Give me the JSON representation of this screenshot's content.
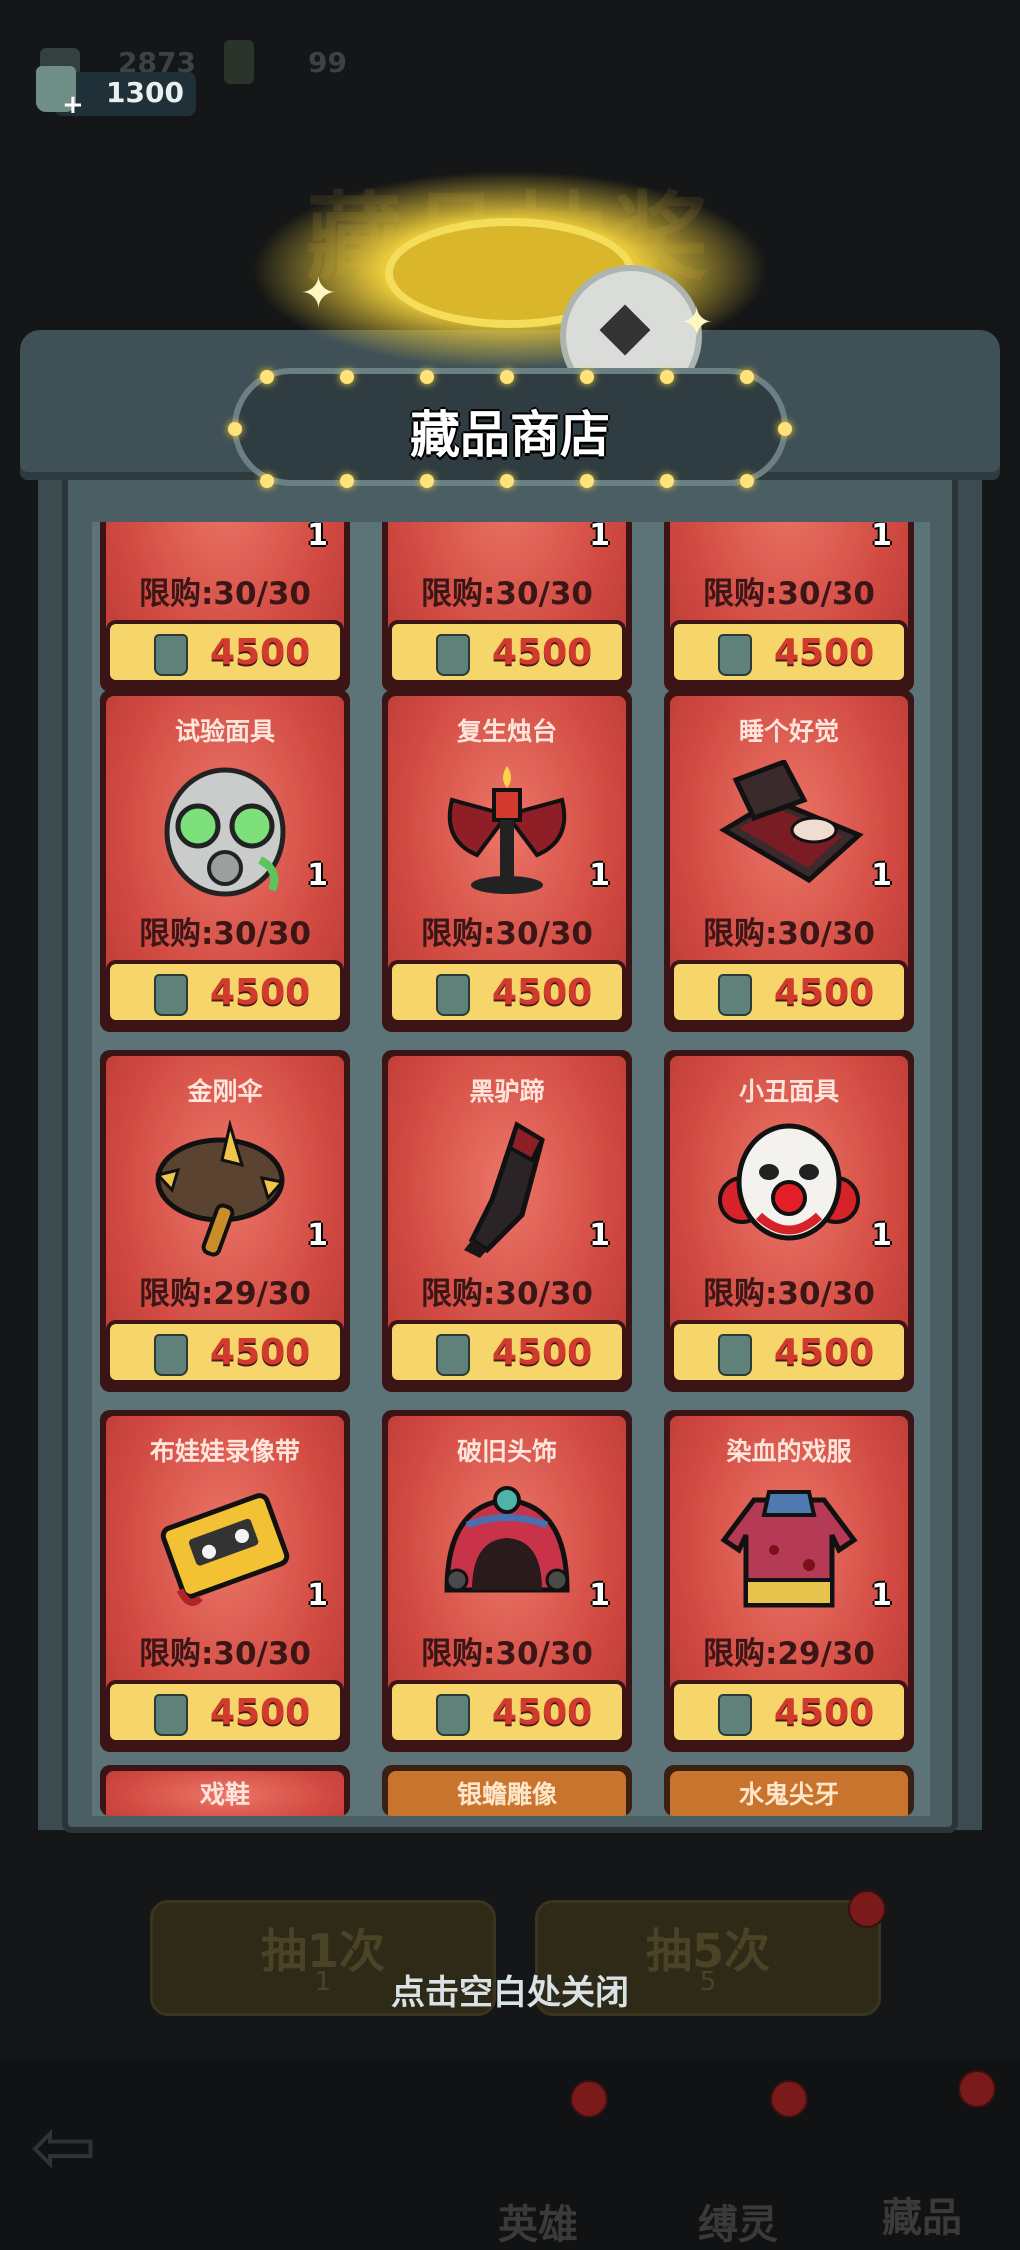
{
  "currency": [
    {
      "amount": "2873",
      "icon": "collectible-token-icon"
    },
    {
      "amount": "99",
      "icon": "key-icon"
    },
    {
      "amount": "1300",
      "icon": "collectible-token-icon"
    }
  ],
  "background": {
    "title": "藏品抽奖",
    "draw_buttons": [
      {
        "label": "抽1次",
        "cost": "1"
      },
      {
        "label": "抽5次",
        "cost": "5"
      }
    ],
    "nav": [
      {
        "label": "英雄"
      },
      {
        "label": "缚灵"
      },
      {
        "label": "藏品"
      }
    ]
  },
  "modal": {
    "title": "藏品商店",
    "close_hint": "点击空白处关闭"
  },
  "shop": {
    "top_row": [
      {
        "count": "1",
        "limit": "限购:30/30",
        "price": "4500"
      },
      {
        "count": "1",
        "limit": "限购:30/30",
        "price": "4500"
      },
      {
        "count": "1",
        "limit": "限购:30/30",
        "price": "4500"
      }
    ],
    "items": [
      {
        "name": "试验面具",
        "count": "1",
        "limit": "限购:30/30",
        "price": "4500",
        "icon": "gas-mask-icon"
      },
      {
        "name": "复生烛台",
        "count": "1",
        "limit": "限购:30/30",
        "price": "4500",
        "icon": "candlestick-icon"
      },
      {
        "name": "睡个好觉",
        "count": "1",
        "limit": "限购:30/30",
        "price": "4500",
        "icon": "coffin-icon"
      },
      {
        "name": "金刚伞",
        "count": "1",
        "limit": "限购:29/30",
        "price": "4500",
        "icon": "spiked-umbrella-icon"
      },
      {
        "name": "黑驴蹄",
        "count": "1",
        "limit": "限购:30/30",
        "price": "4500",
        "icon": "donkey-hoof-icon"
      },
      {
        "name": "小丑面具",
        "count": "1",
        "limit": "限购:30/30",
        "price": "4500",
        "icon": "clown-mask-icon"
      },
      {
        "name": "布娃娃录像带",
        "count": "1",
        "limit": "限购:30/30",
        "price": "4500",
        "icon": "cassette-tape-icon"
      },
      {
        "name": "破旧头饰",
        "count": "1",
        "limit": "限购:30/30",
        "price": "4500",
        "icon": "headdress-icon"
      },
      {
        "name": "染血的戏服",
        "count": "1",
        "limit": "限购:29/30",
        "price": "4500",
        "icon": "costume-icon"
      }
    ],
    "partial_row": [
      {
        "name": "戏鞋"
      },
      {
        "name": "银蟾雕像"
      },
      {
        "name": "水鬼尖牙"
      }
    ]
  }
}
